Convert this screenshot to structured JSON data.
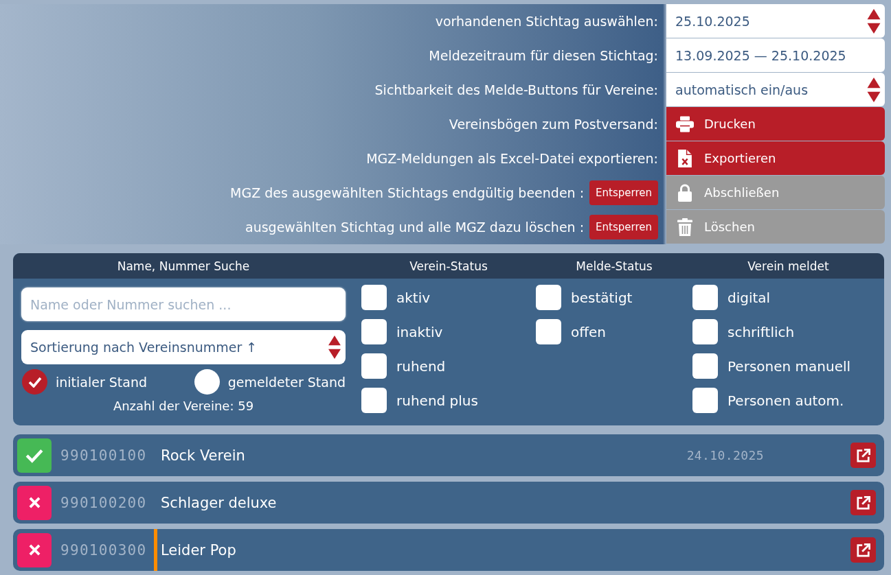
{
  "settings": [
    {
      "kind": "select",
      "label": "vorhandenen Stichtag auswählen:",
      "value": "25.10.2025"
    },
    {
      "kind": "display",
      "label": "Meldezeitraum für diesen Stichtag:",
      "value": "13.09.2025 — 25.10.2025"
    },
    {
      "kind": "select",
      "label": "Sichtbarkeit des Melde-Buttons für Vereine:",
      "value": "automatisch ein/aus"
    },
    {
      "kind": "print",
      "label": "Vereinsbögen zum Postversand:",
      "button": "Drucken",
      "disabled": false
    },
    {
      "kind": "export",
      "label": "MGZ-Meldungen als Excel-Datei exportieren:",
      "button": "Exportieren",
      "disabled": false
    },
    {
      "kind": "lock",
      "label": "MGZ des ausgewählten Stichtags endgültig beenden :",
      "unlock": "Entsperren",
      "button": "Abschließen",
      "disabled": true
    },
    {
      "kind": "delete",
      "label": "ausgewählten Stichtag und alle MGZ dazu löschen :",
      "unlock": "Entsperren",
      "button": "Löschen",
      "disabled": true
    }
  ],
  "filters": {
    "search": {
      "title": "Name, Nummer Suche",
      "placeholder": "Name oder Nummer suchen ...",
      "sort": "Sortierung nach Vereinsnummer ↑",
      "modes": [
        {
          "label": "initialer Stand",
          "selected": true
        },
        {
          "label": "gemeldeter Stand",
          "selected": false
        }
      ],
      "count": "Anzahl der Vereine: 59"
    },
    "groups": [
      {
        "title": "Verein-Status",
        "options": [
          {
            "label": "aktiv",
            "checked": false
          },
          {
            "label": "inaktiv",
            "checked": false
          },
          {
            "label": "ruhend",
            "checked": false
          },
          {
            "label": "ruhend plus",
            "checked": false
          }
        ]
      },
      {
        "title": "Melde-Status",
        "options": [
          {
            "label": "bestätigt",
            "checked": false
          },
          {
            "label": "offen",
            "checked": false
          }
        ]
      },
      {
        "title": "Verein meldet",
        "options": [
          {
            "label": "digital",
            "checked": false
          },
          {
            "label": "schriftlich",
            "checked": false
          },
          {
            "label": "Personen manuell",
            "checked": false
          },
          {
            "label": "Personen autom.",
            "checked": false
          }
        ]
      }
    ]
  },
  "clubs": [
    {
      "confirmed": true,
      "number": "990100100",
      "marked": false,
      "name": "Rock Verein",
      "date": "24.10.2025"
    },
    {
      "confirmed": false,
      "number": "990100200",
      "marked": false,
      "name": "Schlager deluxe"
    },
    {
      "confirmed": false,
      "number": "990100300",
      "marked": true,
      "name": "Leider Pop"
    }
  ]
}
